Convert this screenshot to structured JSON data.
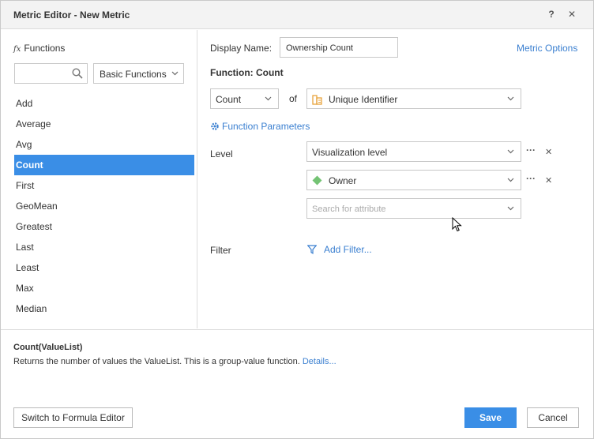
{
  "window": {
    "title": "Metric Editor - New Metric",
    "help_label": "?",
    "close_label": "✕"
  },
  "functions_panel": {
    "header": "Functions",
    "search": {
      "value": "",
      "placeholder": ""
    },
    "category": "Basic Functions",
    "items": [
      "Add",
      "Average",
      "Avg",
      "Count",
      "First",
      "GeoMean",
      "Greatest",
      "Last",
      "Least",
      "Max",
      "Median"
    ],
    "selected": "Count"
  },
  "editor": {
    "display_name_label": "Display Name:",
    "display_name_value": "Ownership Count",
    "metric_options": "Metric Options",
    "function_heading": "Function: Count",
    "function_select": "Count",
    "of_label": "of",
    "object_select": "Unique Identifier",
    "function_parameters": "Function Parameters",
    "level_label": "Level",
    "levels": [
      "Visualization level",
      "Owner"
    ],
    "attribute_search_placeholder": "Search for attribute",
    "more_label": "···",
    "remove_label": "✕",
    "filter_label": "Filter",
    "add_filter": "Add Filter..."
  },
  "help": {
    "signature": "Count(ValueList)",
    "description": "Returns the number of values the ValueList. This is a group-value function.",
    "details_link": "Details..."
  },
  "footer": {
    "switch_button": "Switch to Formula Editor",
    "save_button": "Save",
    "cancel_button": "Cancel"
  },
  "colors": {
    "accent": "#3a8ee6",
    "link": "#3a7fd0",
    "attribute_icon": "#5cb85c",
    "dataset_icon": "#e8a33d"
  }
}
